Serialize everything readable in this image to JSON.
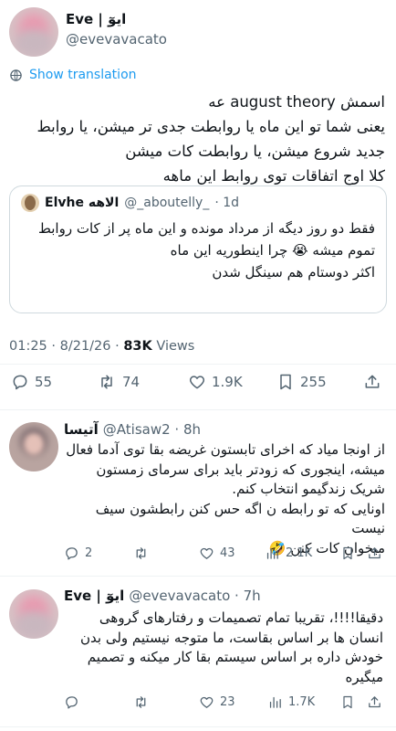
{
  "main_tweet": {
    "display_name": "Eve | ایوٓ",
    "handle": "@evevavacato",
    "show_translation": "Show translation",
    "lines": [
      "اسمش august theory عه",
      "یعنی شما تو این ماه یا روابطت جدی تر میشن، یا روابط",
      "جدید شروع میشن، یا روابطت کات میشن",
      "کلا اوج اتفاقات توی روابط این ماهه"
    ],
    "quote": {
      "display_name": "Elvhe الاهه",
      "handle": "@_aboutelly_",
      "time": "· 1d",
      "lines": [
        "فقط دو روز دیگه از مرداد مونده و این ماه پر از کات روابط",
        "تموم میشه 😭 چرا اینطوریه این ماه",
        "اکثر دوستام هم سینگل شدن"
      ]
    },
    "time": "01:25 · 8/21/26 · ",
    "views_count": "83K",
    "views_label": " Views",
    "replies": "55",
    "retweets": "74",
    "likes": "1.9K",
    "bookmarks": "255"
  },
  "replies": [
    {
      "display_name": "آتیسا",
      "handle": "@Atisaw2 · 8h",
      "lines": [
        "از اونجا میاد که اخرای تابستون غریضه بقا توی آدما فعال",
        "میشه، اینجوری که زودتر باید برای سرمای زمستون",
        "شریک زندگیمو انتخاب کنم.",
        "اونایی که تو رابطه ن اگه حس کنن رابطشون سیف نیست",
        "میخوان کات کنن 🤣"
      ],
      "replies": "2",
      "retweets": "",
      "likes": "43",
      "views": "2.1K"
    },
    {
      "display_name": "Eve | ایوٓ",
      "handle": "@evevavacato · 7h",
      "lines": [
        "دقیقا!!!!، تقریبا تمام تصمیمات و رفتارهای گروهی",
        "انسان ها بر اساس بقاست، ما متوجه نیستیم ولی بدن",
        "خودش داره بر اساس سیستم بقا کار میکنه و تصمیم",
        "میگیره"
      ],
      "replies": "",
      "retweets": "",
      "likes": "23",
      "views": "1.7K"
    }
  ],
  "colors": {
    "link": "#1d9bf0",
    "text": "#0f1419",
    "muted": "#536471",
    "border": "#eff3f4"
  }
}
